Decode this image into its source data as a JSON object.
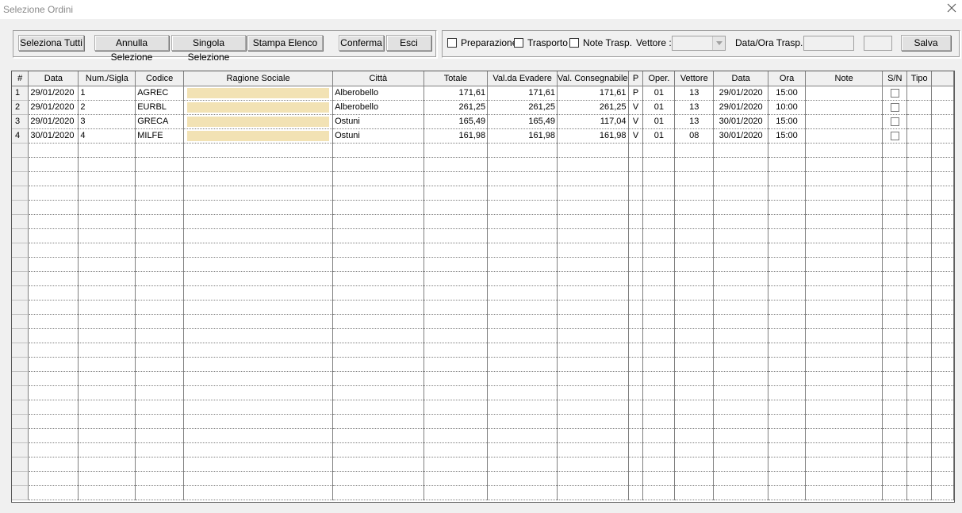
{
  "window": {
    "title": "Selezione Ordini",
    "close_icon": "close-icon"
  },
  "toolbar": {
    "select_all": "Seleziona Tutti",
    "cancel_selection": "Annulla Selezione",
    "single_selection": "Singola Selezione",
    "print_list": "Stampa Elenco",
    "confirm": "Conferma",
    "exit": "Esci",
    "preparazione": "Preparazione",
    "trasporto": "Trasporto",
    "note_trasp": "Note Trasp.",
    "vettore_label": "Vettore :",
    "vettore_value": "",
    "data_ora_label": "Data/Ora Trasp. :",
    "data_value": "",
    "ora_value": "",
    "save": "Salva"
  },
  "grid": {
    "columns": [
      "#",
      "Data",
      "Num./Sigla",
      "Codice",
      "Ragione Sociale",
      "Città",
      "Totale",
      "Val.da Evadere",
      "Val. Consegnabile",
      "P",
      "Oper.",
      "Vettore",
      "Data",
      "Ora",
      "Note",
      "S/N",
      "Tipo"
    ],
    "rows": [
      {
        "idx": "1",
        "data": "29/01/2020",
        "num": "1",
        "codice": "AGREC",
        "ragione": "",
        "citta": "Alberobello",
        "totale": "171,61",
        "evadere": "171,61",
        "consegnabile": "171,61",
        "p": "P",
        "oper": "01",
        "vettore": "13",
        "data2": "29/01/2020",
        "ora": "15:00",
        "note": "",
        "sn": false,
        "tipo": ""
      },
      {
        "idx": "2",
        "data": "29/01/2020",
        "num": "2",
        "codice": "EURBL",
        "ragione": "",
        "citta": "Alberobello",
        "totale": "261,25",
        "evadere": "261,25",
        "consegnabile": "261,25",
        "p": "V",
        "oper": "01",
        "vettore": "13",
        "data2": "29/01/2020",
        "ora": "10:00",
        "note": "",
        "sn": false,
        "tipo": ""
      },
      {
        "idx": "3",
        "data": "29/01/2020",
        "num": "3",
        "codice": "GRECA",
        "ragione": "",
        "citta": "Ostuni",
        "totale": "165,49",
        "evadere": "165,49",
        "consegnabile": "117,04",
        "p": "V",
        "oper": "01",
        "vettore": "13",
        "data2": "30/01/2020",
        "ora": "15:00",
        "note": "",
        "sn": false,
        "tipo": ""
      },
      {
        "idx": "4",
        "data": "30/01/2020",
        "num": "4",
        "codice": "MILFE",
        "ragione": "",
        "citta": "Ostuni",
        "totale": "161,98",
        "evadere": "161,98",
        "consegnabile": "161,98",
        "p": "V",
        "oper": "01",
        "vettore": "08",
        "data2": "30/01/2020",
        "ora": "15:00",
        "note": "",
        "sn": false,
        "tipo": ""
      }
    ],
    "empty_row_count": 25
  },
  "colors": {
    "window_bg": "#f0f0f0",
    "highlight_cell": "#f2e2b4",
    "grid_line": "#808080"
  }
}
